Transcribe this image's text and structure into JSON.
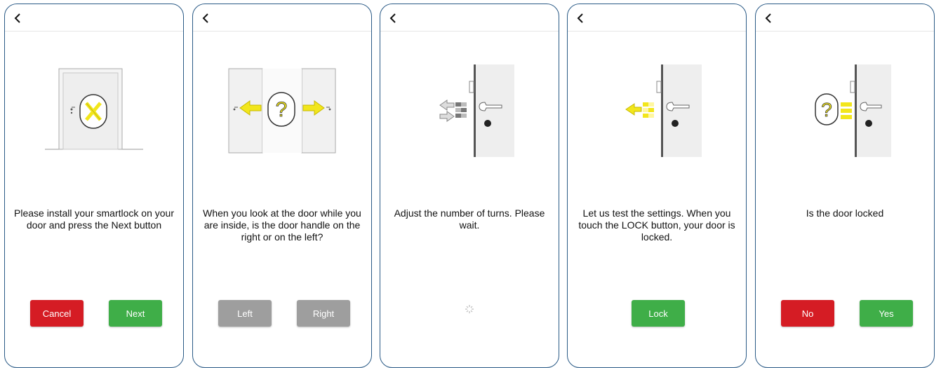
{
  "screens": [
    {
      "message": "Please install your smartlock on your door and press the Next button",
      "buttons": [
        {
          "label": "Cancel",
          "color": "#d51c24"
        },
        {
          "label": "Next",
          "color": "#3fae48"
        }
      ]
    },
    {
      "message": "When you look at the door while you are inside, is the door handle on the right or on the left?",
      "buttons": [
        {
          "label": "Left",
          "color": "#9e9e9e"
        },
        {
          "label": "Right",
          "color": "#9e9e9e"
        }
      ]
    },
    {
      "message": "Adjust the number of turns. Please wait.",
      "status": "loading"
    },
    {
      "message": "Let us test the settings. When you touch the LOCK button, your door is locked.",
      "buttons": [
        {
          "label": "Lock",
          "color": "#3fae48"
        }
      ]
    },
    {
      "message": "Is the door locked",
      "buttons": [
        {
          "label": "No",
          "color": "#d51c24"
        },
        {
          "label": "Yes",
          "color": "#3fae48"
        }
      ]
    }
  ],
  "icons": {
    "back": "chevron-left-icon",
    "install": "tools-icon",
    "question": "question-mark-icon",
    "spinner": "loading-spinner-icon"
  },
  "colors": {
    "frame": "#2a5a86",
    "accent_yellow": "#f2e61c"
  }
}
